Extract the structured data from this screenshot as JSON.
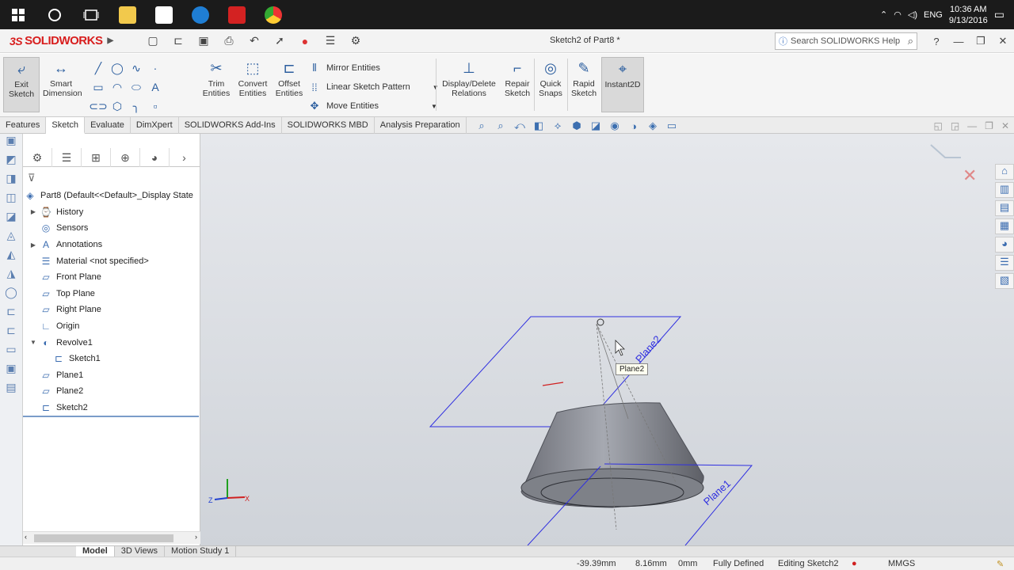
{
  "taskbar": {
    "clock_time": "10:36 AM",
    "clock_date": "9/13/2016",
    "language": "ENG",
    "apps": [
      "start-icon",
      "cortana-icon",
      "task-view-icon",
      "file-explorer-icon",
      "store-icon",
      "edge-icon",
      "solidworks-app-icon",
      "chrome-icon"
    ]
  },
  "titlebar": {
    "brand": "SOLIDWORKS",
    "document_title": "Sketch2 of Part8 *",
    "search_placeholder": "Search SOLIDWORKS Help"
  },
  "ribbon": {
    "exit_sketch": "Exit Sketch",
    "smart_dimension": "Smart Dimension",
    "trim_entities": "Trim Entities",
    "convert_entities": "Convert Entities",
    "offset_entities": "Offset Entities",
    "mirror_entities": "Mirror Entities",
    "linear_sketch_pattern": "Linear Sketch Pattern",
    "move_entities": "Move Entities",
    "display_delete_relations": "Display/Delete Relations",
    "repair_sketch": "Repair Sketch",
    "quick_snaps": "Quick Snaps",
    "rapid_sketch": "Rapid Sketch",
    "instant2d": "Instant2D"
  },
  "tabs": [
    "Features",
    "Sketch",
    "Evaluate",
    "DimXpert",
    "SOLIDWORKS Add-Ins",
    "SOLIDWORKS MBD",
    "Analysis Preparation"
  ],
  "active_tab": "Sketch",
  "tree": {
    "root": "Part8  (Default<<Default>_Display State",
    "nodes": [
      {
        "label": "History",
        "icon": "history-icon",
        "expandable": true
      },
      {
        "label": "Sensors",
        "icon": "sensors-icon",
        "expandable": false
      },
      {
        "label": "Annotations",
        "icon": "annotations-icon",
        "expandable": true
      },
      {
        "label": "Material <not specified>",
        "icon": "material-icon",
        "expandable": false
      },
      {
        "label": "Front Plane",
        "icon": "plane-icon",
        "expandable": false
      },
      {
        "label": "Top Plane",
        "icon": "plane-icon",
        "expandable": false
      },
      {
        "label": "Right Plane",
        "icon": "plane-icon",
        "expandable": false
      },
      {
        "label": "Origin",
        "icon": "origin-icon",
        "expandable": false
      },
      {
        "label": "Revolve1",
        "icon": "revolve-icon",
        "expandable": true
      },
      {
        "label": "Sketch1",
        "icon": "sketch-icon",
        "expandable": false
      },
      {
        "label": "Plane1",
        "icon": "plane-icon",
        "expandable": false
      },
      {
        "label": "Plane2",
        "icon": "plane-icon",
        "expandable": false
      },
      {
        "label": "Sketch2",
        "icon": "sketch-icon",
        "expandable": false
      }
    ]
  },
  "viewport": {
    "tooltip": "Plane2",
    "plane1_label": "Plane1",
    "plane2_label": "Plane2",
    "axis_z": "Z",
    "axis_x": "X",
    "plane_color": "#3030e0"
  },
  "bottom_tabs": [
    "Model",
    "3D Views",
    "Motion Study 1"
  ],
  "active_bottom_tab": "Model",
  "status": {
    "x": "-39.39mm",
    "y": "8.16mm",
    "z": "0mm",
    "definition": "Fully Defined",
    "mode": "Editing Sketch2",
    "units": "MMGS"
  }
}
